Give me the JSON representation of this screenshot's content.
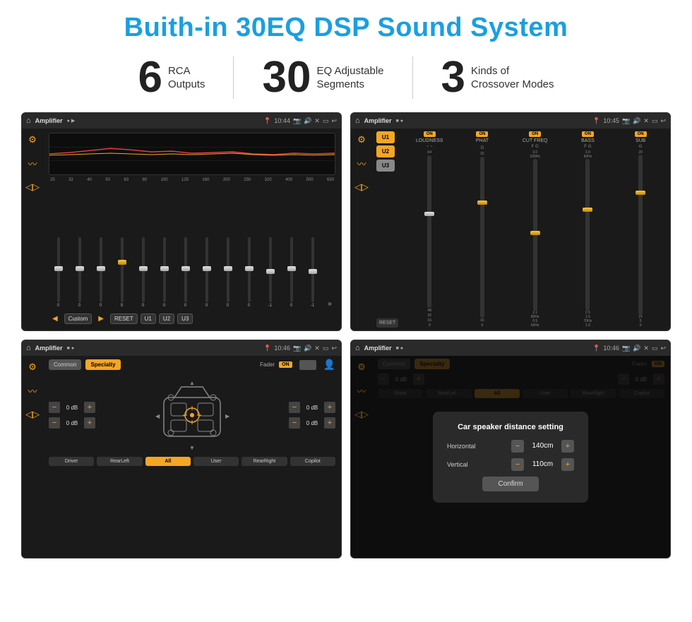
{
  "page": {
    "title": "Buith-in 30EQ DSP Sound System",
    "stats": [
      {
        "number": "6",
        "label_line1": "RCA",
        "label_line2": "Outputs"
      },
      {
        "number": "30",
        "label_line1": "EQ Adjustable",
        "label_line2": "Segments"
      },
      {
        "number": "3",
        "label_line1": "Kinds of",
        "label_line2": "Crossover Modes"
      }
    ]
  },
  "screens": {
    "eq_screen": {
      "topbar": {
        "title": "Amplifier",
        "time": "10:44"
      },
      "freq_labels": [
        "25",
        "32",
        "40",
        "50",
        "63",
        "80",
        "100",
        "125",
        "160",
        "200",
        "250",
        "320",
        "400",
        "500",
        "630"
      ],
      "slider_values": [
        "0",
        "0",
        "0",
        "5",
        "0",
        "0",
        "0",
        "0",
        "0",
        "0",
        "-1",
        "0",
        "-1"
      ],
      "bottom_buttons": [
        "Custom",
        "RESET",
        "U1",
        "U2",
        "U3"
      ]
    },
    "crossover_screen": {
      "topbar": {
        "title": "Amplifier",
        "time": "10:45"
      },
      "unit_buttons": [
        "U1",
        "U2",
        "U3"
      ],
      "controls": [
        {
          "label": "LOUDNESS",
          "on": true
        },
        {
          "label": "PHAT",
          "on": true
        },
        {
          "label": "CUT FREQ",
          "on": true
        },
        {
          "label": "BASS",
          "on": true
        },
        {
          "label": "SUB",
          "on": true
        }
      ],
      "reset_label": "RESET"
    },
    "fader_screen": {
      "topbar": {
        "title": "Amplifier",
        "time": "10:46"
      },
      "buttons": {
        "common": "Common",
        "specialty": "Specialty"
      },
      "fader_label": "Fader",
      "on_label": "ON",
      "db_controls": [
        {
          "value": "0 dB"
        },
        {
          "value": "0 dB"
        },
        {
          "value": "0 dB"
        },
        {
          "value": "0 dB"
        }
      ],
      "bottom_buttons": [
        "Driver",
        "RearLeft",
        "All",
        "User",
        "RearRight",
        "Copilot"
      ]
    },
    "dialog_screen": {
      "topbar": {
        "title": "Amplifier",
        "time": "10:46"
      },
      "dialog": {
        "title": "Car speaker distance setting",
        "horizontal_label": "Horizontal",
        "horizontal_value": "140cm",
        "vertical_label": "Vertical",
        "vertical_value": "110cm",
        "confirm_label": "Confirm"
      },
      "bottom_buttons": [
        "Driver",
        "RearLef...",
        "All",
        "User",
        "RearRight",
        "Copilot"
      ]
    }
  },
  "colors": {
    "accent": "#f5a623",
    "blue": "#1a9fe0",
    "bg_dark": "#1a1a1a",
    "text_light": "#ffffff"
  }
}
